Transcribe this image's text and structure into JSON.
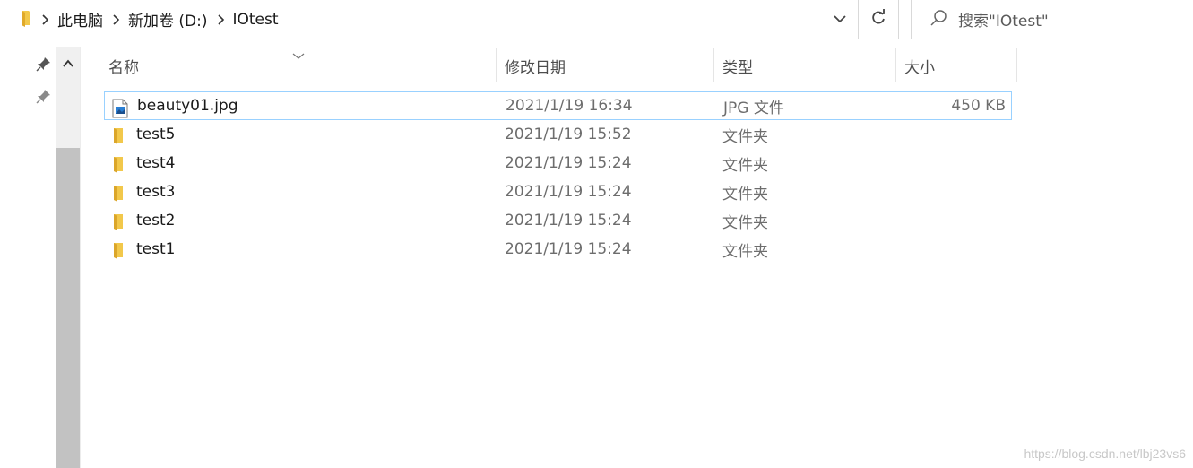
{
  "address_bar": {
    "crumbs": [
      "此电脑",
      "新加卷 (D:)",
      "IOtest"
    ]
  },
  "search": {
    "placeholder": "搜索\"IOtest\""
  },
  "columns": {
    "name": "名称",
    "date": "修改日期",
    "type": "类型",
    "size": "大小"
  },
  "files": [
    {
      "name": "beauty01.jpg",
      "date": "2021/1/19 16:34",
      "type": "JPG 文件",
      "size": "450 KB",
      "icon": "jpg-file-icon"
    },
    {
      "name": "test5",
      "date": "2021/1/19 15:52",
      "type": "文件夹",
      "size": "",
      "icon": "folder-icon"
    },
    {
      "name": "test4",
      "date": "2021/1/19 15:24",
      "type": "文件夹",
      "size": "",
      "icon": "folder-icon"
    },
    {
      "name": "test3",
      "date": "2021/1/19 15:24",
      "type": "文件夹",
      "size": "",
      "icon": "folder-icon"
    },
    {
      "name": "test2",
      "date": "2021/1/19 15:24",
      "type": "文件夹",
      "size": "",
      "icon": "folder-icon"
    },
    {
      "name": "test1",
      "date": "2021/1/19 15:24",
      "type": "文件夹",
      "size": "",
      "icon": "folder-icon"
    }
  ],
  "watermark": "https://blog.csdn.net/lbj23vs6",
  "colors": {
    "folder": "#f2c84b",
    "selection_border": "#99d1ff",
    "scroll_thumb": "#c2c2c2"
  }
}
